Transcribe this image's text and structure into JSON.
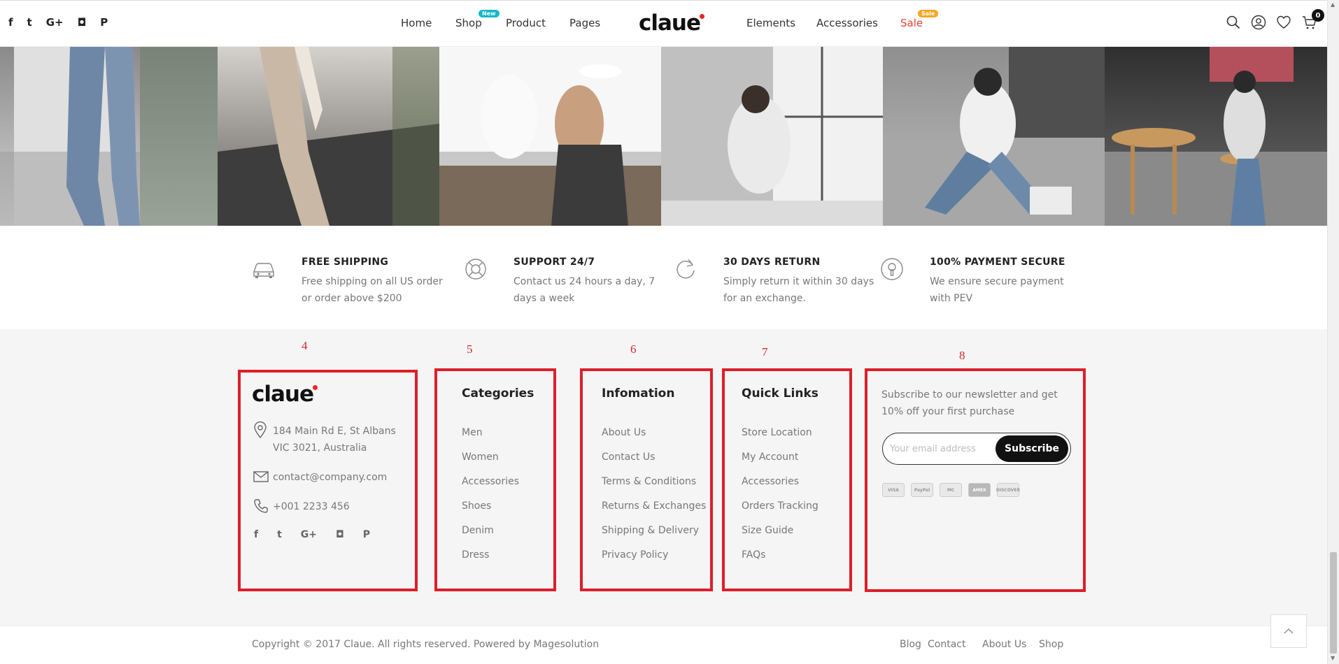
{
  "header": {
    "social_icons": [
      "facebook-icon",
      "twitter-icon",
      "google-plus-icon",
      "instagram-icon",
      "pinterest-icon"
    ],
    "social_glyphs": [
      "f",
      "t",
      "G+",
      "◘",
      "P"
    ],
    "nav_left": [
      {
        "label": "Home"
      },
      {
        "label": "Shop",
        "badge": "New",
        "badge_color": "#16b8c6"
      },
      {
        "label": "Product"
      },
      {
        "label": "Pages"
      }
    ],
    "logo": "claue",
    "nav_right": [
      {
        "label": "Elements"
      },
      {
        "label": "Accessories"
      },
      {
        "label": "Sale",
        "badge": "Sale",
        "badge_color": "#f5a623",
        "label_color": "#e44332"
      }
    ],
    "icons": [
      "search-icon",
      "user-icon",
      "heart-icon",
      "cart-icon"
    ],
    "cart_count": "0"
  },
  "features": [
    {
      "icon": "car-icon",
      "title": "FREE SHIPPING",
      "text": "Free shipping on all US order or order above $200"
    },
    {
      "icon": "lifebuoy-icon",
      "title": "SUPPORT 24/7",
      "text": "Contact us 24 hours a day, 7 days a week"
    },
    {
      "icon": "return-icon",
      "title": "30 DAYS RETURN",
      "text": "Simply return it within 30 days for an exchange."
    },
    {
      "icon": "lock-icon",
      "title": "100% PAYMENT SECURE",
      "text": "We ensure secure payment with PEV"
    }
  ],
  "annotations": [
    "4",
    "5",
    "6",
    "7",
    "8"
  ],
  "footer": {
    "logo": "claue",
    "address_1": "184 Main Rd E, St Albans",
    "address_2": "VIC 3021, Australia",
    "email": "contact@company.com",
    "phone": "+001 2233 456",
    "social_glyphs": [
      "f",
      "t",
      "G+",
      "◘",
      "P"
    ],
    "categories": {
      "title": "Categories",
      "items": [
        "Men",
        "Women",
        "Accessories",
        "Shoes",
        "Denim",
        "Dress"
      ]
    },
    "information": {
      "title": "Infomation",
      "items": [
        "About Us",
        "Contact Us",
        "Terms & Conditions",
        "Returns & Exchanges",
        "Shipping & Delivery",
        "Privacy Policy"
      ]
    },
    "quick_links": {
      "title": "Quick Links",
      "items": [
        "Store Location",
        "My Account",
        "Accessories",
        "Orders Tracking",
        "Size Guide",
        "FAQs"
      ]
    },
    "newsletter": {
      "text": "Subscribe to our newsletter and get 10% off your first purchase",
      "placeholder": "Your email address",
      "button": "Subscribe"
    },
    "payments": [
      "VISA",
      "PayPal",
      "MC",
      "AMEX",
      "DISCOVER"
    ]
  },
  "bottom": {
    "copyright": "Copyright © 2017 Claue. All rights reserved. Powered by Magesolution",
    "links": [
      "Blog",
      "Contact",
      "About Us",
      "Shop"
    ]
  },
  "colors": {
    "accent_red": "#dd1f2a",
    "sale": "#e44332",
    "badge_new": "#16b8c6",
    "badge_sale": "#f5a623"
  }
}
